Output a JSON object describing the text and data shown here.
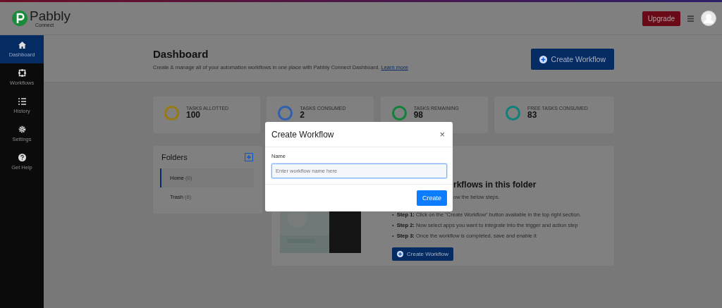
{
  "brand": {
    "name": "Pabbly",
    "sub": "Connect"
  },
  "topbar": {
    "upgrade": "Upgrade"
  },
  "sidebar": {
    "items": [
      {
        "label": "Dashboard",
        "selected": true
      },
      {
        "label": "Workflows",
        "selected": false
      },
      {
        "label": "History",
        "selected": false
      },
      {
        "label": "Settings",
        "selected": false
      },
      {
        "label": "Get Help",
        "selected": false
      }
    ]
  },
  "header": {
    "title": "Dashboard",
    "subtitle": "Create & manage all of your automation workflows in one place with Pabbly Connect Dashboard.",
    "link": "Learn more",
    "button": "Create Workflow"
  },
  "stats": [
    {
      "label": "TASKS ALLOTTED",
      "value": "100",
      "color": "#9a7a10"
    },
    {
      "label": "TASKS CONSUMED",
      "value": "2",
      "color": "#2f5fae"
    },
    {
      "label": "TASKS REMAINING",
      "value": "98",
      "color": "#12803a"
    },
    {
      "label": "FREE TASKS CONSUMED",
      "value": "83",
      "color": "#0e7f7b"
    }
  ],
  "folders": {
    "title": "Folders",
    "items": [
      {
        "name": "Home",
        "count": "(0)",
        "selected": true
      },
      {
        "name": "Trash",
        "count": "(8)",
        "selected": false
      }
    ]
  },
  "empty_state": {
    "title": "rkflows in this folder",
    "subtitle": "ow the below steps.",
    "steps": [
      {
        "marker": "•",
        "label": "Step 1:",
        "text": "Click on the \"Create Workflow\" button available in the top right section."
      },
      {
        "marker": "•",
        "label": "Step 2:",
        "text": "Now select apps you want to integrate into the trigger and action step"
      },
      {
        "marker": "•",
        "label": "Step 3:",
        "text": "Once the workflow is completed, save and enable it"
      }
    ],
    "button": "Create Workflow"
  },
  "modal": {
    "title": "Create Workflow",
    "close": "×",
    "field_label": "Name",
    "placeholder": "Enter workflow name here",
    "button": "Create"
  }
}
